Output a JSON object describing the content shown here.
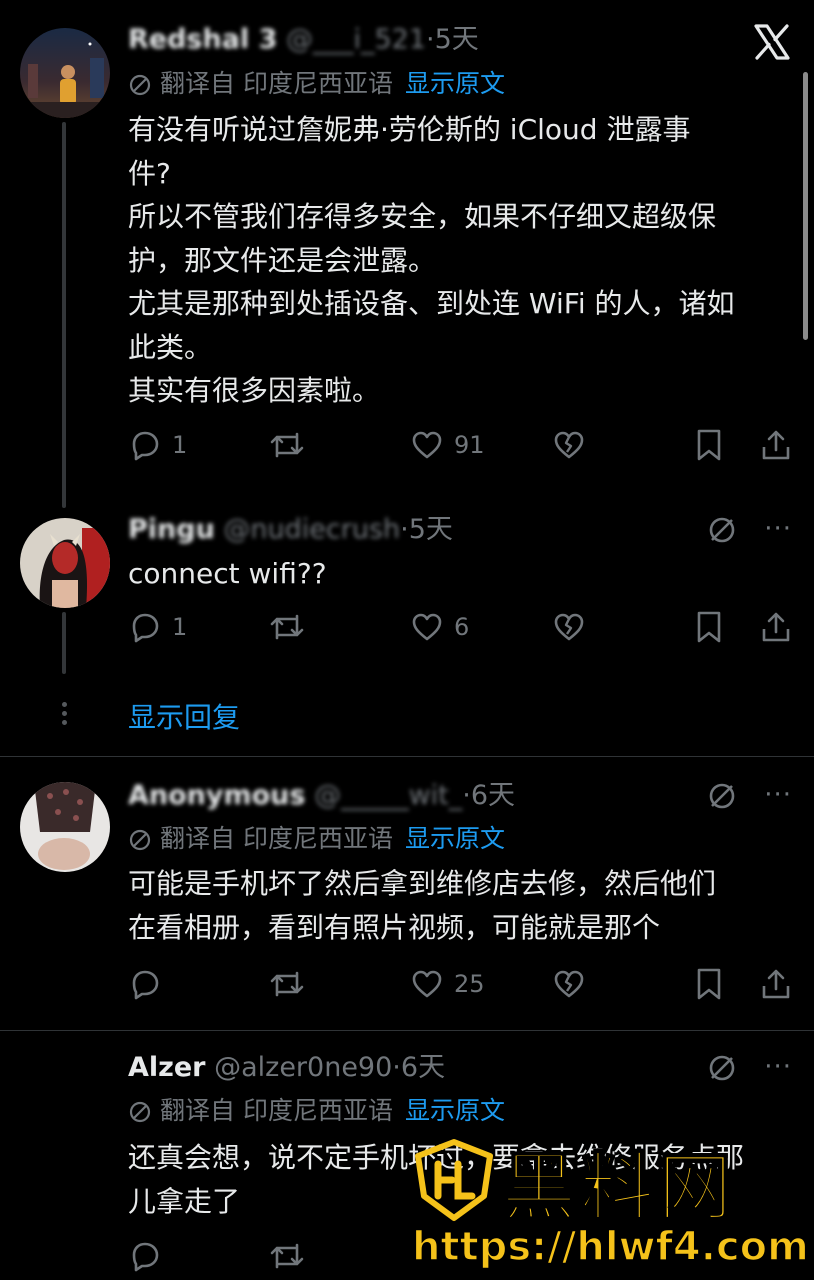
{
  "colors": {
    "background": "#000000",
    "text": "#e7e9ea",
    "secondary": "#71767b",
    "link": "#1d9bf0",
    "divider": "#2f3336",
    "watermark": "#f5c21a"
  },
  "close_icon": "x-logo-icon",
  "posts": [
    {
      "name": "Redshal 3",
      "handle": "@___i_521",
      "time": "5天",
      "translation": {
        "label": "翻译自 印度尼西亚语",
        "show_original": "显示原文"
      },
      "body_lines": [
        "有没有听说过詹妮弗·劳伦斯的 iCloud 泄露事",
        "件?",
        "所以不管我们存得多安全，如果不仔细又超级保",
        "护，那文件还是会泄露。",
        "尤其是那种到处插设备、到处连 WiFi 的人，诸如",
        "此类。",
        "其实有很多因素啦。"
      ],
      "replies": "1",
      "reposts": "",
      "likes": "91"
    },
    {
      "name": "Pingu",
      "handle": "@nudiecrush",
      "time": "5天",
      "body_lines": [
        "connect wifi??"
      ],
      "replies": "1",
      "reposts": "",
      "likes": "6"
    },
    {
      "name": "Anonymous",
      "handle": "@_____wit_",
      "time": "6天",
      "translation": {
        "label": "翻译自 印度尼西亚语",
        "show_original": "显示原文"
      },
      "body_lines": [
        "可能是手机坏了然后拿到维修店去修，然后他们",
        "在看相册，看到有照片视频，可能就是那个"
      ],
      "replies": "",
      "reposts": "",
      "likes": "25"
    },
    {
      "name": "Alzer",
      "handle": "@alzer0ne90",
      "time": "6天",
      "translation": {
        "label": "翻译自 印度尼西亚语",
        "show_original": "显示原文"
      },
      "body_lines": [
        "还真会想，说不定手机坏过，要拿去维修服务点那",
        "儿拿走了"
      ],
      "replies": "",
      "reposts": "",
      "likes": ""
    }
  ],
  "show_replies": "显示回复",
  "watermark": {
    "text": "黑料网",
    "url": "https://hlwf4.com"
  },
  "dot": "·",
  "more": "···"
}
